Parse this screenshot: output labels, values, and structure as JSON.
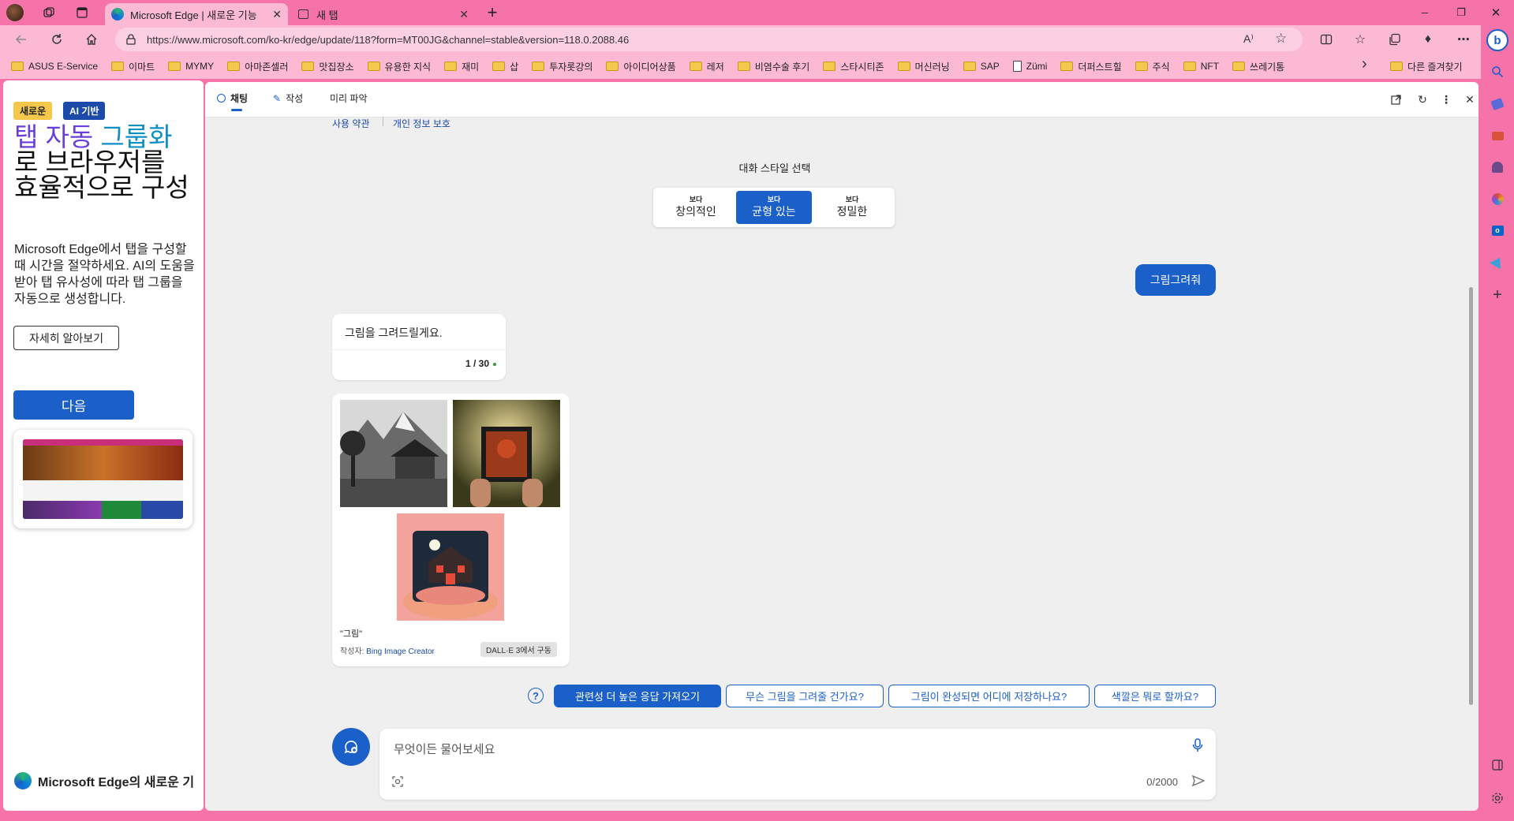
{
  "window": {
    "tabs": [
      {
        "title": "Microsoft Edge | 새로운 기능",
        "active": true
      },
      {
        "title": "새 탭",
        "active": false
      }
    ],
    "new_tab_label": "+",
    "controls": {
      "minimize": "─",
      "restore": "❐",
      "close": "✕"
    }
  },
  "address_bar": {
    "url": "https://www.microsoft.com/ko-kr/edge/update/118?form=MT00JG&channel=stable&version=118.0.2088.46"
  },
  "favorites": {
    "items": [
      {
        "label": "ASUS E-Service",
        "type": "folder"
      },
      {
        "label": "이마트",
        "type": "folder"
      },
      {
        "label": "MYMY",
        "type": "folder"
      },
      {
        "label": "아마존셀러",
        "type": "folder"
      },
      {
        "label": "맛집장소",
        "type": "folder"
      },
      {
        "label": "유용한 지식",
        "type": "folder"
      },
      {
        "label": "재미",
        "type": "folder"
      },
      {
        "label": "삽",
        "type": "folder"
      },
      {
        "label": "투자롯강의",
        "type": "folder"
      },
      {
        "label": "아이디어상품",
        "type": "folder"
      },
      {
        "label": "레저",
        "type": "folder"
      },
      {
        "label": "비염수술 후기",
        "type": "folder"
      },
      {
        "label": "스타시티존",
        "type": "folder"
      },
      {
        "label": "머신러닝",
        "type": "folder"
      },
      {
        "label": "SAP",
        "type": "folder"
      },
      {
        "label": "Zümi",
        "type": "page"
      },
      {
        "label": "더퍼스트힐",
        "type": "folder"
      },
      {
        "label": "주식",
        "type": "folder"
      },
      {
        "label": "NFT",
        "type": "folder"
      },
      {
        "label": "쓰레기통",
        "type": "folder"
      }
    ],
    "overflow": "›",
    "other": "다른 즐겨찾기"
  },
  "left_page": {
    "badge_new": "새로운",
    "badge_ai": "AI 기반",
    "hero_part1": "탭 자동 ",
    "hero_part2": "그룹화",
    "hero_part3": "로 브라우저를 효율적으로 구성",
    "description": "Microsoft Edge에서 탭을 구성할 때 시간을 절약하세요. AI의 도움을 받아 탭 유사성에 따라 탭 그룹을 자동으로 생성합니다.",
    "learn_more": "자세히 알아보기",
    "next": "다음",
    "footer": "Microsoft Edge의 새로운 기"
  },
  "copilot": {
    "tabs": [
      {
        "label": "채팅",
        "active": true
      },
      {
        "label": "작성",
        "active": false
      },
      {
        "label": "미리 파악",
        "active": false
      }
    ],
    "links": {
      "terms": "사용 약관",
      "privacy": "개인 정보 보호"
    },
    "style_title": "대화 스타일 선택",
    "styles": [
      {
        "small": "보다",
        "label": "창의적인",
        "active": false
      },
      {
        "small": "보다",
        "label": "균형 있는",
        "active": true
      },
      {
        "small": "보다",
        "label": "정밀한",
        "active": false
      }
    ],
    "user_message": "그림그려줘",
    "bot_message": "그림을 그려드릴게요.",
    "bot_count": "1 / 30",
    "image_caption": "\"그림\"",
    "image_author_prefix": "작성자: ",
    "image_author": "Bing Image Creator",
    "image_tag": "DALL·E 3에서 구동",
    "suggestions": [
      "관련성 더 높은 응답 가져오기",
      "무슨 그림을 그려줄 건가요?",
      "그림이 완성되면 어디에 저장하나요?",
      "색깔은 뭐로 할까요?"
    ],
    "input_placeholder": "무엇이든 물어보세요",
    "char_count": "0/2000"
  },
  "colors": {
    "frame": "#f573a8",
    "frame_light": "#fbb9d4",
    "accent": "#1b5fc8",
    "badge_new": "#f5c84c"
  },
  "icons": [
    "back-icon",
    "refresh-icon",
    "home-icon",
    "lock-icon",
    "read-aloud-icon",
    "favorite-star-icon",
    "split-screen-icon",
    "favorites-icon",
    "collections-icon",
    "extensions-icon",
    "more-icon",
    "bing-icon",
    "search-icon",
    "tools-icon",
    "games-icon",
    "office-icon",
    "outlook-icon",
    "send-icon",
    "add-icon",
    "sidebar-icon",
    "settings-icon"
  ]
}
